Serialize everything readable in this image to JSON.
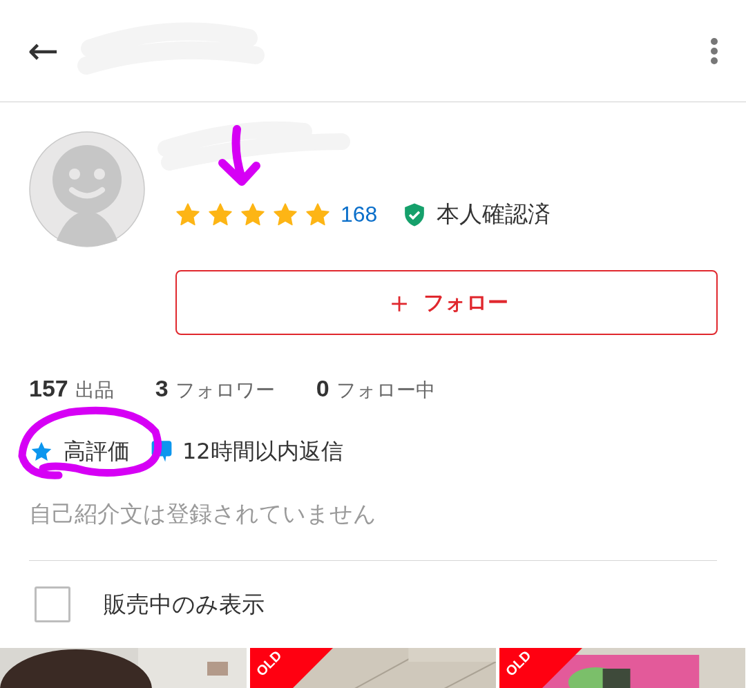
{
  "header": {
    "back_icon": "←"
  },
  "profile": {
    "stars": 5,
    "rating_count": "168",
    "verified_label": "本人確認済",
    "follow_button": {
      "plus": "＋",
      "label": "フォロー"
    }
  },
  "stats": [
    {
      "value": "157",
      "label": "出品"
    },
    {
      "value": "3",
      "label": "フォロワー"
    },
    {
      "value": "0",
      "label": "フォロー中"
    }
  ],
  "badges": [
    {
      "kind": "star",
      "label": "高評価"
    },
    {
      "kind": "chat",
      "label": "12時間以内返信"
    }
  ],
  "bio": "自己紹介文は登録されていません",
  "filter": {
    "label": "販売中のみ表示",
    "checked": false
  },
  "items": [
    {
      "kind": "picture",
      "sold": false
    },
    {
      "kind": "picture",
      "sold": true,
      "sold_label": "OLD"
    },
    {
      "kind": "picture",
      "sold": true,
      "sold_label": "OLD"
    }
  ]
}
